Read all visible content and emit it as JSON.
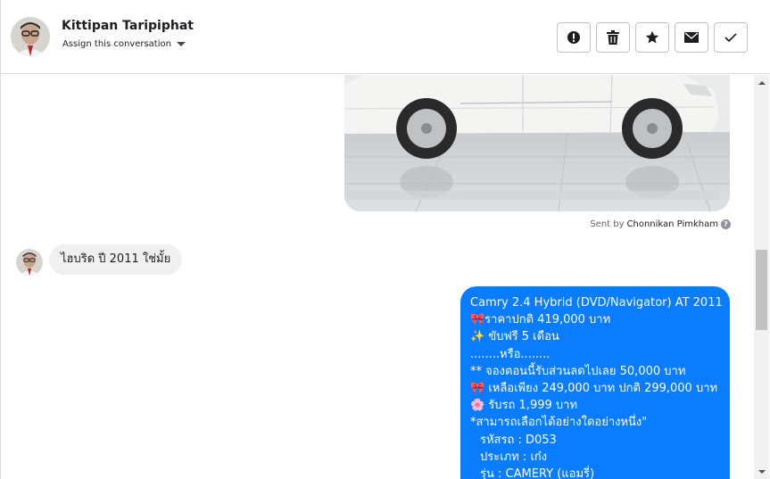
{
  "header": {
    "contact_name": "Kittipan Taripiphat",
    "assign_label": "Assign this conversation",
    "actions": [
      {
        "icon": "alert-icon",
        "label": "Mark as spam"
      },
      {
        "icon": "trash-icon",
        "label": "Delete"
      },
      {
        "icon": "star-icon",
        "label": "Follow up"
      },
      {
        "icon": "envelope-icon",
        "label": "Mark as unread"
      },
      {
        "icon": "check-icon",
        "label": "Mark as done"
      }
    ]
  },
  "thread": {
    "image_message": {
      "sent_by_prefix": "Sent by",
      "author": "Chonnikan Pimkham",
      "help_icon": "question-icon"
    },
    "incoming_message": {
      "text": "ไฮบริด ปี 2011 ใช่มั้ย"
    },
    "outgoing_message": {
      "lines": [
        "Camry 2.4 Hybrid (DVD/Navigator) AT 2011",
        "🎀ราคาปกติ 419,000 บาท",
        "✨ ขับฟรี 5 เดือน",
        "........หรือ........",
        "** จองตอนนี้รับส่วนลดไปเลย 50,000 บาท",
        "🎀 เหลือเพียง 249,000 บาท ปกติ 299,000 บาท",
        "🌸 รับรถ 1,999 บาท",
        "*สามารถเลือกได้อย่างใดอย่างหนึ่ง\"",
        "รหัสรถ : D053",
        "ประเภท : เก๋ง",
        " รุ่น : CAMERY (แอมรี่)"
      ]
    }
  },
  "colors": {
    "outgoing_bubble": "#0a7cff",
    "incoming_bubble": "#f0f0f0",
    "border": "#dadde1"
  }
}
